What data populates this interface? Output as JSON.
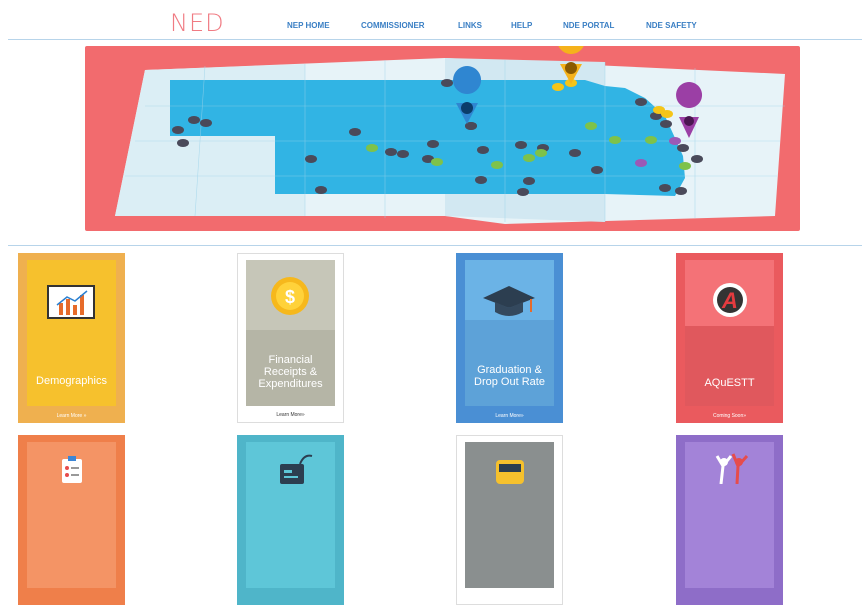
{
  "header": {
    "logo_text": "NED",
    "nav": [
      "NEP HOME",
      "COMMISSIONER",
      "LINKS",
      "HELP",
      "NDE PORTAL",
      "NDE SAFETY"
    ]
  },
  "hero": {
    "icon": "nebraska-map-illustration"
  },
  "cards": [
    {
      "title": "Demographics",
      "link": "Learn More »",
      "icon": "bar-chart-icon"
    },
    {
      "title": "Financial Receipts & Expenditures",
      "link": "Learn More»",
      "icon": "dollar-coin-icon"
    },
    {
      "title": "Graduation & Drop Out Rate",
      "link": "Learn More»",
      "icon": "graduation-cap-icon"
    },
    {
      "title": "AQuESTT",
      "link": "Coming Soon»",
      "icon": "aquestt-logo-icon"
    }
  ],
  "row2_cards": [
    {
      "icon": "clipboard-icon"
    },
    {
      "icon": "id-card-icon"
    },
    {
      "icon": "school-bus-icon"
    },
    {
      "icon": "people-celebrating-icon"
    }
  ],
  "colors": {
    "accent": "#3a7fc4",
    "hero": "#f26b6e",
    "demographics": "#efb04f",
    "financial": "#ffffff",
    "graduation": "#4a8fd4",
    "aquestt": "#ea5a5e"
  }
}
